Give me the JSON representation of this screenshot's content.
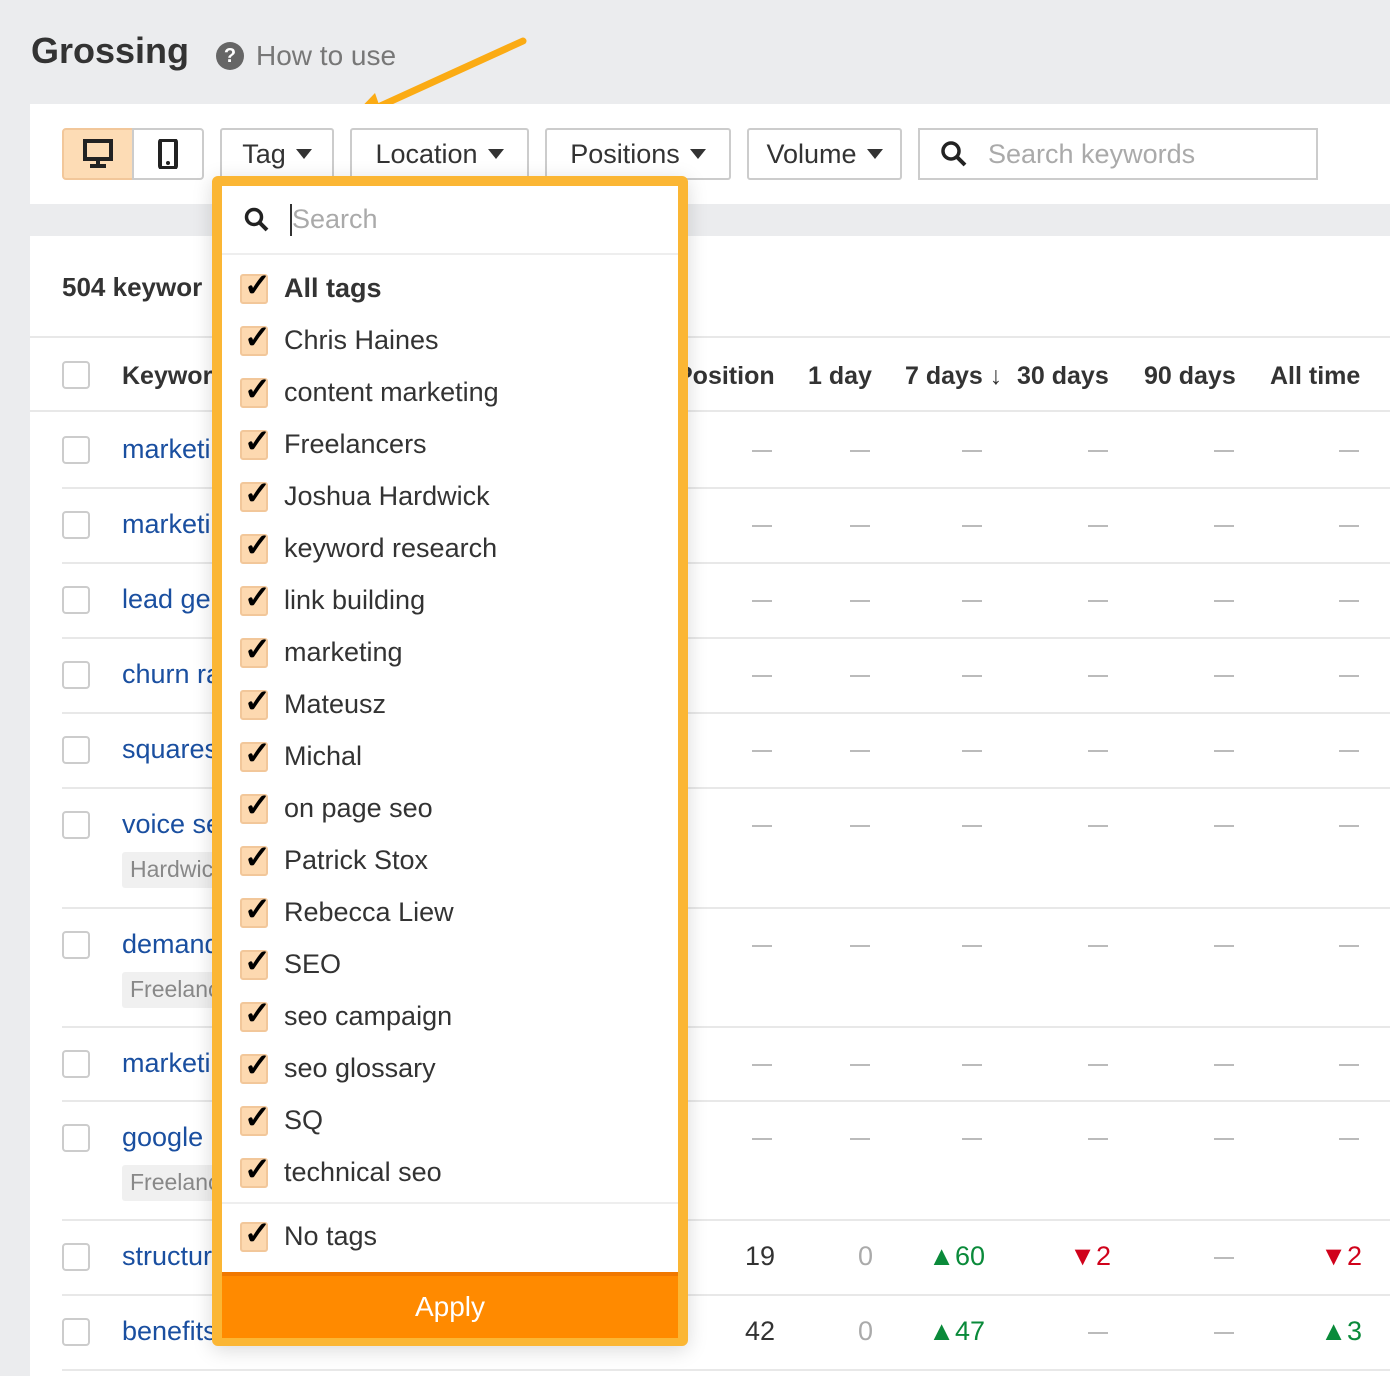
{
  "header": {
    "title": "Grossing",
    "help_label": "How to use"
  },
  "toolbar": {
    "filters": [
      "Tag",
      "Location",
      "Positions",
      "Volume"
    ],
    "search_placeholder": "Search keywords",
    "device_selected": "desktop"
  },
  "table": {
    "count_label": "504 keywor",
    "columns": [
      "Keywor",
      "Position",
      "1 day",
      "7 days ↓",
      "30 days",
      "90 days",
      "All time"
    ],
    "rows": [
      {
        "keyword": "marketi",
        "tag": "",
        "position": "—",
        "d1": "—",
        "d7": "—",
        "d30": "—",
        "d90": "—",
        "all": "—"
      },
      {
        "keyword": "marketi",
        "tag": "",
        "position": "—",
        "d1": "—",
        "d7": "—",
        "d30": "—",
        "d90": "—",
        "all": "—"
      },
      {
        "keyword": "lead ge",
        "tag": "",
        "position": "—",
        "d1": "—",
        "d7": "—",
        "d30": "—",
        "d90": "—",
        "all": "—"
      },
      {
        "keyword": "churn ra",
        "tag": "",
        "position": "—",
        "d1": "—",
        "d7": "—",
        "d30": "—",
        "d90": "—",
        "all": "—"
      },
      {
        "keyword": "squares",
        "tag": "",
        "position": "—",
        "d1": "—",
        "d7": "—",
        "d30": "—",
        "d90": "—",
        "all": "—"
      },
      {
        "keyword": "voice se",
        "tag": "Hardwick",
        "position": "—",
        "d1": "—",
        "d7": "—",
        "d30": "—",
        "d90": "—",
        "all": "—"
      },
      {
        "keyword": "demand",
        "tag": "Freelanc",
        "position": "—",
        "d1": "—",
        "d7": "—",
        "d30": "—",
        "d90": "—",
        "all": "—"
      },
      {
        "keyword": "marketi",
        "tag": "",
        "position": "—",
        "d1": "—",
        "d7": "—",
        "d30": "—",
        "d90": "—",
        "all": "—"
      },
      {
        "keyword": "google p",
        "tag": "Freelanc",
        "position": "—",
        "d1": "—",
        "d7": "—",
        "d30": "—",
        "d90": "—",
        "all": "—"
      },
      {
        "keyword": "structur",
        "tag": "",
        "position": "19",
        "d1": "0",
        "d7": "▲60",
        "d30": "▼2",
        "d90": "—",
        "all": "▼2"
      },
      {
        "keyword": "benefits",
        "tag": "",
        "position": "42",
        "d1": "0",
        "d7": "▲47",
        "d30": "—",
        "d90": "—",
        "all": "▲3"
      }
    ]
  },
  "dropdown": {
    "search_placeholder": "Search",
    "all_label": "All tags",
    "tags": [
      "Chris Haines",
      "content marketing",
      "Freelancers",
      "Joshua Hardwick",
      "keyword research",
      "link building",
      "marketing",
      "Mateusz",
      "Michal",
      "on page seo",
      "Patrick Stox",
      "Rebecca Liew",
      "SEO",
      "seo campaign",
      "seo glossary",
      "SQ",
      "technical seo"
    ],
    "no_tags_label": "No tags",
    "apply_label": "Apply",
    "check_glyph": "✓"
  },
  "colors": {
    "accent": "#ff8a00",
    "highlight_border": "#fbb634",
    "link": "#1a4fa0",
    "up": "#0a8a3a",
    "down": "#d0021b"
  }
}
